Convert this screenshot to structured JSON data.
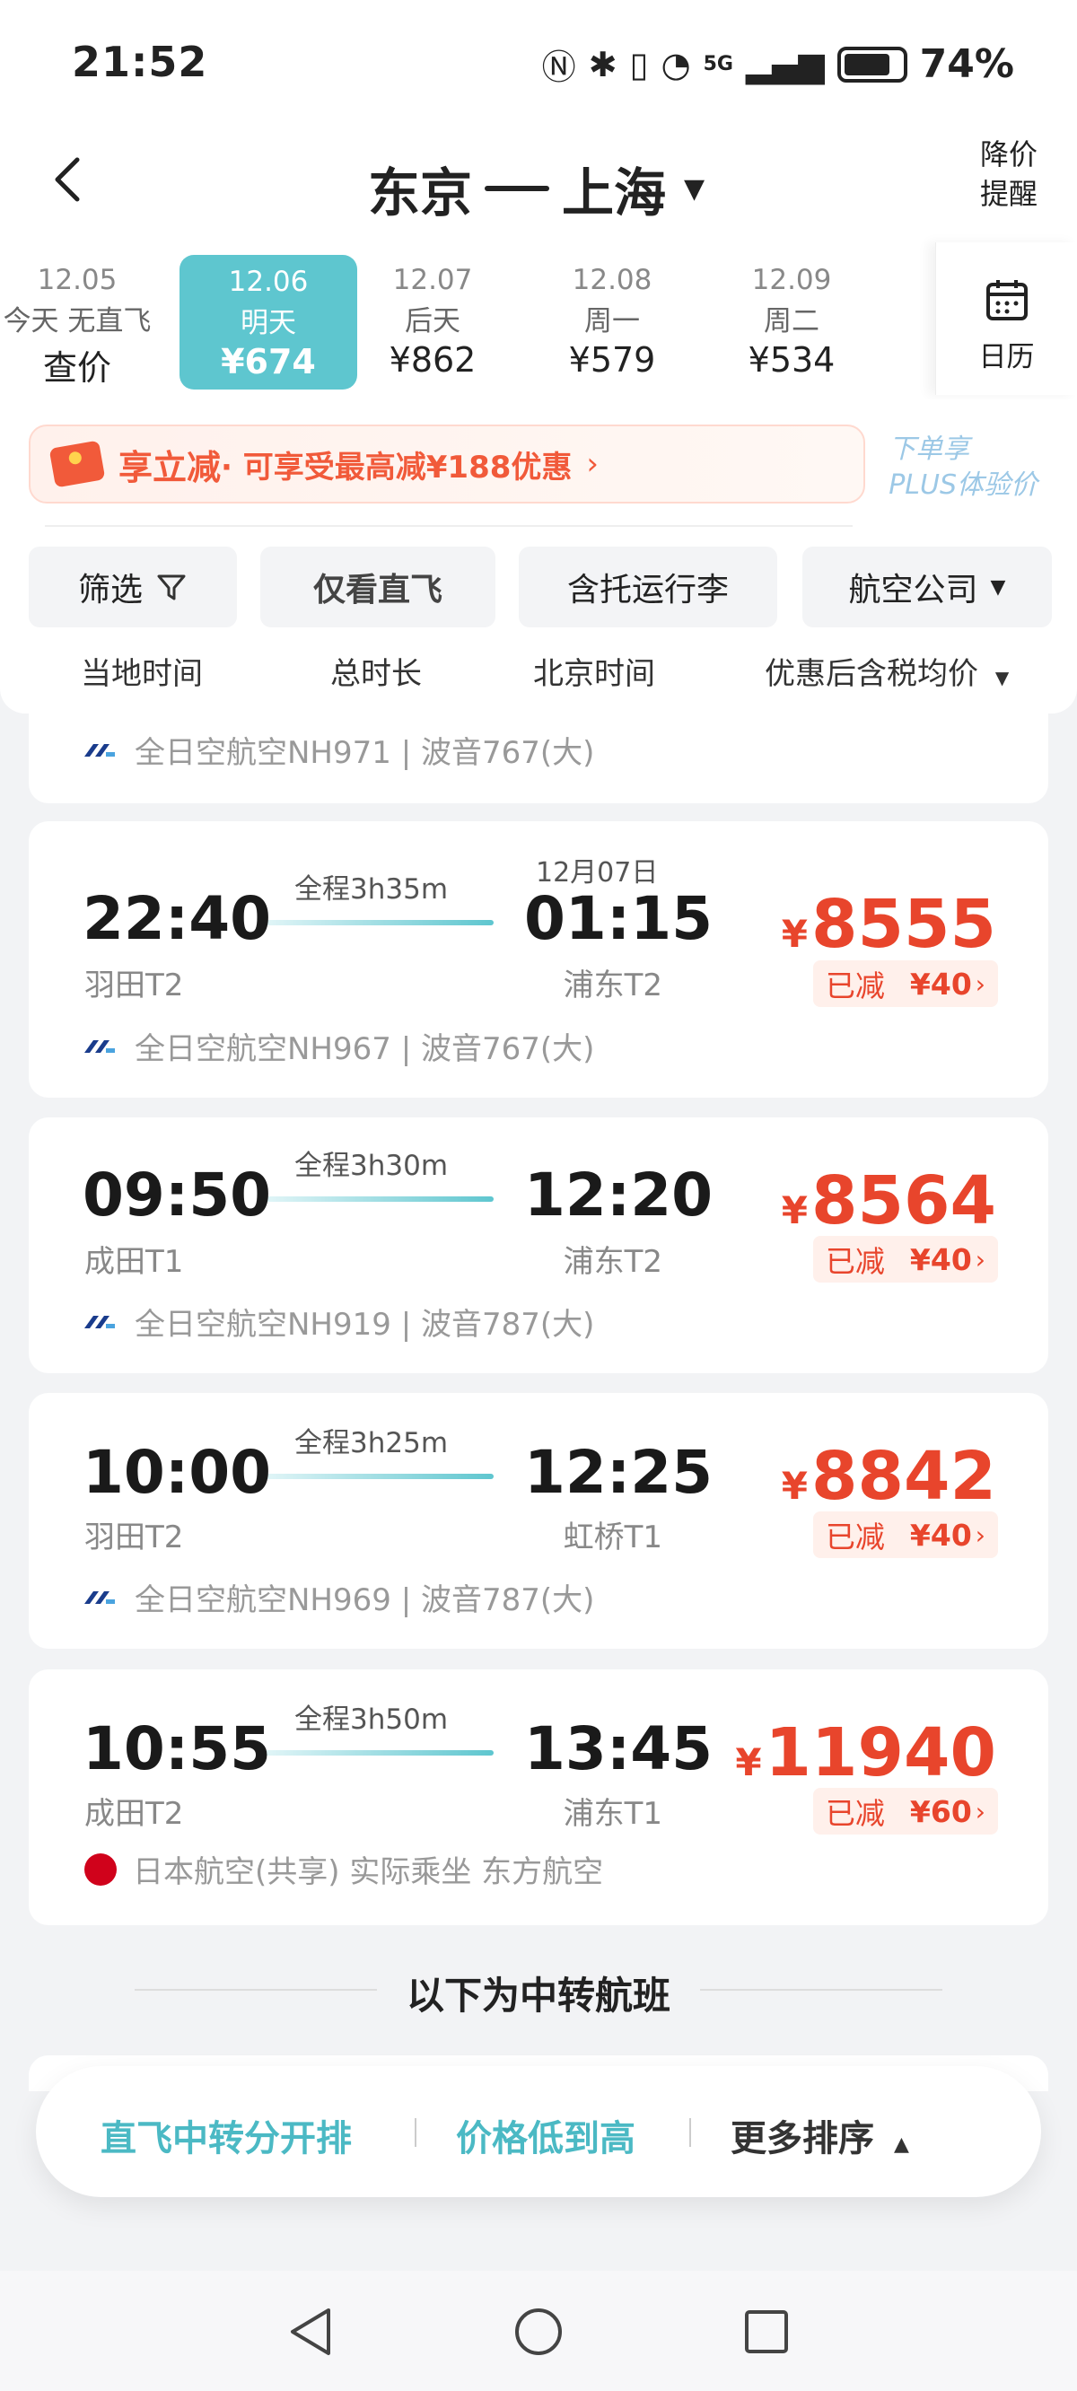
{
  "status": {
    "time": "21:52",
    "battery": "74%",
    "network": "5G"
  },
  "header": {
    "origin": "东京",
    "destination": "上海",
    "price_alert_line1": "降价",
    "price_alert_line2": "提醒"
  },
  "dates": [
    {
      "date": "12.05",
      "label": "今天 无直飞",
      "price": "查价"
    },
    {
      "date": "12.06",
      "label": "明天",
      "price": "¥674",
      "selected": true
    },
    {
      "date": "12.07",
      "label": "后天",
      "price": "¥862"
    },
    {
      "date": "12.08",
      "label": "周一",
      "price": "¥579"
    },
    {
      "date": "12.09",
      "label": "周二",
      "price": "¥534"
    }
  ],
  "calendar_label": "日历",
  "promo": {
    "title": "享立减",
    "text": "· 可享受最高减¥188优惠",
    "plus_line1": "下单享",
    "plus_line2": "PLUS体验价"
  },
  "filters": [
    "筛选",
    "仅看直飞",
    "含托运行李",
    "航空公司"
  ],
  "sort_headers": [
    "当地时间",
    "总时长",
    "北京时间",
    "优惠后含税均价"
  ],
  "first_card_airline": "全日空航空NH971 | 波音767(大)",
  "flights": [
    {
      "dep_time": "22:40",
      "dep_airport": "羽田T2",
      "duration": "全程3h35m",
      "arr_date": "12月07日",
      "arr_time": "01:15",
      "arr_airport": "浦东T2",
      "price": "8555",
      "discount_label": "已减",
      "discount_amount": "¥40",
      "airline": "全日空航空NH967 | 波音767(大)"
    },
    {
      "dep_time": "09:50",
      "dep_airport": "成田T1",
      "duration": "全程3h30m",
      "arr_date": "",
      "arr_time": "12:20",
      "arr_airport": "浦东T2",
      "price": "8564",
      "discount_label": "已减",
      "discount_amount": "¥40",
      "airline": "全日空航空NH919 | 波音787(大)"
    },
    {
      "dep_time": "10:00",
      "dep_airport": "羽田T2",
      "duration": "全程3h25m",
      "arr_date": "",
      "arr_time": "12:25",
      "arr_airport": "虹桥T1",
      "price": "8842",
      "discount_label": "已减",
      "discount_amount": "¥40",
      "airline": "全日空航空NH969 | 波音787(大)"
    },
    {
      "dep_time": "10:55",
      "dep_airport": "成田T2",
      "duration": "全程3h50m",
      "arr_date": "",
      "arr_time": "13:45",
      "arr_airport": "浦东T1",
      "price": "11940",
      "discount_label": "已减",
      "discount_amount": "¥60",
      "airline": "日本航空(共享) 实际乘坐 东方航空"
    }
  ],
  "transfer_divider": "以下为中转航班",
  "bottom_sort": {
    "opt1": "直飞中转分开排",
    "opt2": "价格低到高",
    "opt3": "更多排序"
  },
  "colors": {
    "accent": "#5ec6cf",
    "price": "#e8452c"
  }
}
